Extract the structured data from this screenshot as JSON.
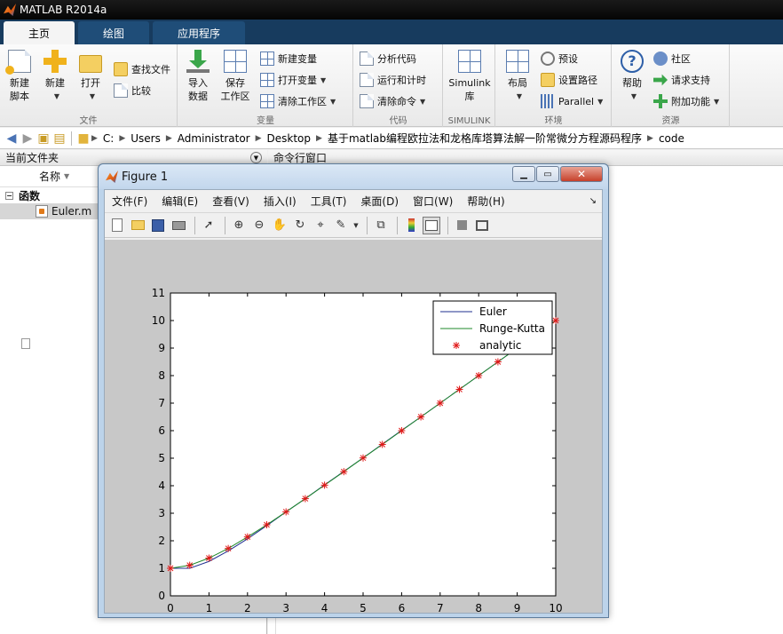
{
  "app": {
    "title": "MATLAB R2014a"
  },
  "tabs": [
    {
      "label": "主页",
      "active": true
    },
    {
      "label": "绘图",
      "active": false
    },
    {
      "label": "应用程序",
      "active": false
    }
  ],
  "ribbon": {
    "file": {
      "label": "文件",
      "new_script": [
        "新建",
        "脚本"
      ],
      "new": "新建",
      "open": "打开",
      "find_files": "查找文件",
      "compare": "比较"
    },
    "variable": {
      "label": "变量",
      "import": [
        "导入",
        "数据"
      ],
      "save": [
        "保存",
        "工作区"
      ],
      "new_var": "新建变量",
      "open_var": "打开变量",
      "clear_ws": "清除工作区"
    },
    "code": {
      "label": "代码",
      "analyze": "分析代码",
      "run_time": "运行和计时",
      "clear_cmd": "清除命令"
    },
    "simulink": {
      "label": "SIMULINK",
      "lib": [
        "Simulink",
        "库"
      ]
    },
    "env": {
      "label": "环境",
      "layout": "布局",
      "prefs": "预设",
      "set_path": "设置路径",
      "parallel": "Parallel"
    },
    "resources": {
      "label": "资源",
      "help": "帮助",
      "community": "社区",
      "support": "请求支持",
      "addons": "附加功能"
    }
  },
  "address": {
    "crumbs": [
      "C:",
      "Users",
      "Administrator",
      "Desktop",
      "基于matlab编程欧拉法和龙格库塔算法解一阶常微分方程源码程序",
      "code"
    ]
  },
  "current_folder": {
    "title": "当前文件夹",
    "col_name": "名称",
    "group": "函数",
    "file": "Euler.m"
  },
  "command_window": {
    "title": "命令行窗口"
  },
  "figure": {
    "title": "Figure 1",
    "menus": [
      "文件(F)",
      "编辑(E)",
      "查看(V)",
      "插入(I)",
      "工具(T)",
      "桌面(D)",
      "窗口(W)",
      "帮助(H)"
    ]
  },
  "chart_data": {
    "type": "line",
    "xlim": [
      0,
      10
    ],
    "ylim": [
      0,
      11
    ],
    "xticks": [
      0,
      1,
      2,
      3,
      4,
      5,
      6,
      7,
      8,
      9,
      10
    ],
    "yticks": [
      0,
      1,
      2,
      3,
      4,
      5,
      6,
      7,
      8,
      9,
      10,
      11
    ],
    "legend_position": "top-right",
    "grid": false,
    "series": [
      {
        "name": "Euler",
        "style": "line",
        "color": "#1f2f8f",
        "x": [
          0,
          0.5,
          1,
          1.5,
          2,
          2.5,
          3,
          3.5,
          4,
          4.5,
          5,
          5.5,
          6,
          6.5,
          7,
          7.5,
          8,
          8.5,
          9,
          9.5,
          10
        ],
        "y": [
          1,
          1,
          1.25,
          1.63,
          2.07,
          2.55,
          3.05,
          3.53,
          4.03,
          4.52,
          5.01,
          5.51,
          6.01,
          6.5,
          7.0,
          7.5,
          8.0,
          8.5,
          9.0,
          9.5,
          10.0
        ]
      },
      {
        "name": "Runge-Kutta",
        "style": "line",
        "color": "#1f8a2a",
        "x": [
          0,
          0.5,
          1,
          1.5,
          2,
          2.5,
          3,
          3.5,
          4,
          4.5,
          5,
          5.5,
          6,
          6.5,
          7,
          7.5,
          8,
          8.5,
          9,
          9.5,
          10
        ],
        "y": [
          1,
          1.11,
          1.37,
          1.72,
          2.14,
          2.58,
          3.05,
          3.53,
          4.02,
          4.51,
          5.01,
          5.5,
          6.0,
          6.5,
          7.0,
          7.5,
          8.0,
          8.5,
          9.0,
          9.5,
          10.0
        ]
      },
      {
        "name": "analytic",
        "style": "markers",
        "color": "#e01818",
        "x": [
          0,
          0.5,
          1,
          1.5,
          2,
          2.5,
          3,
          3.5,
          4,
          4.5,
          5,
          5.5,
          6,
          6.5,
          7,
          7.5,
          8,
          8.5,
          9,
          9.5,
          10
        ],
        "y": [
          1,
          1.11,
          1.37,
          1.72,
          2.14,
          2.58,
          3.05,
          3.53,
          4.02,
          4.51,
          5.01,
          5.5,
          6.0,
          6.5,
          7.0,
          7.5,
          8.0,
          8.5,
          9.0,
          9.5,
          10.0
        ]
      }
    ]
  }
}
